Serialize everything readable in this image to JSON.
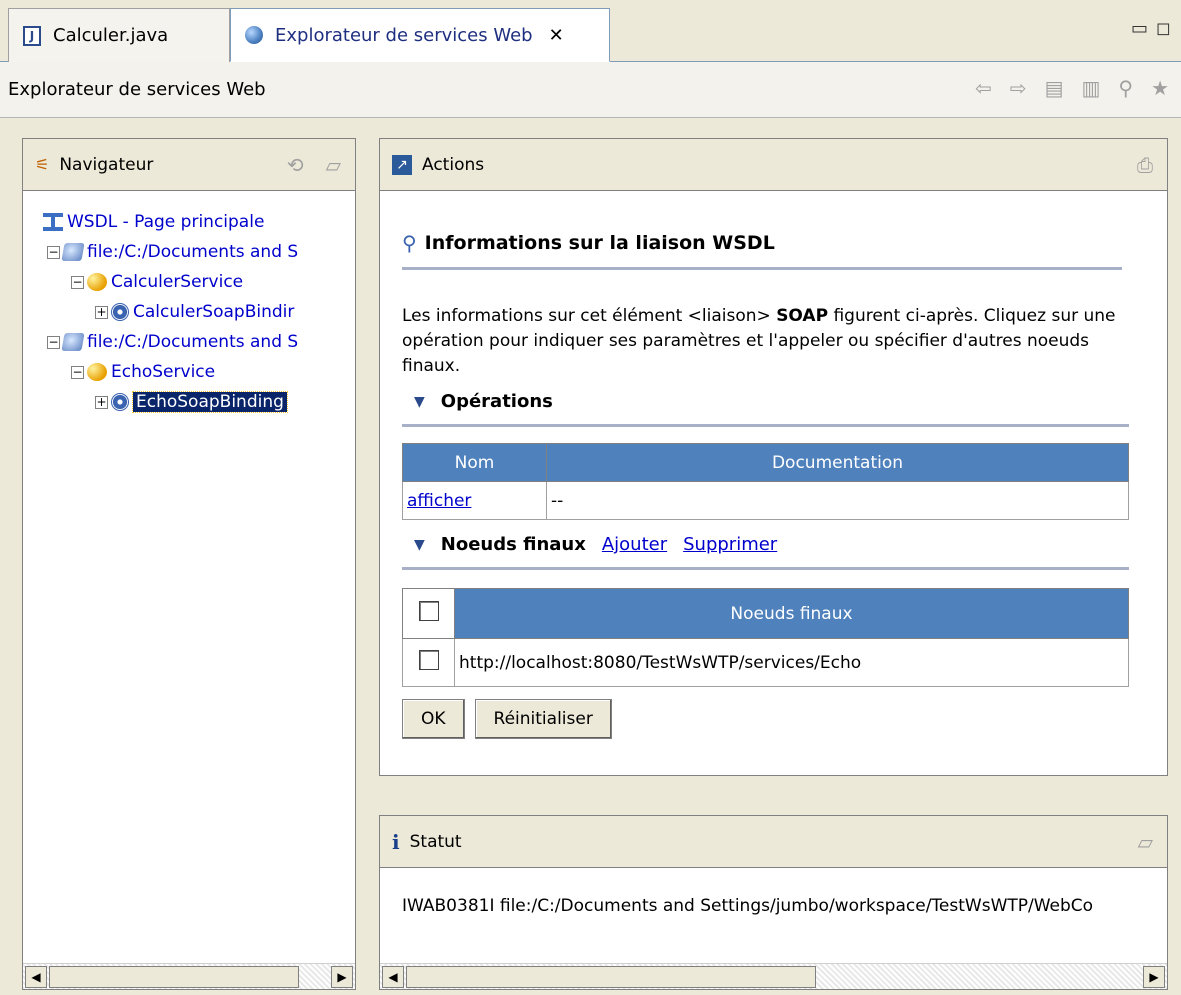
{
  "tabs": [
    {
      "label": "Calculer.java",
      "icon": "java-file-icon",
      "active": false
    },
    {
      "label": "Explorateur de services Web",
      "icon": "globe-icon",
      "active": true,
      "close": "✕"
    }
  ],
  "window_controls": {
    "minimize": "▭",
    "maximize": "◻"
  },
  "title": "Explorateur de services Web",
  "toolbar": [
    "back-icon",
    "forward-icon",
    "document-icon",
    "favorites-page-icon",
    "wsdl-search-icon",
    "star-icon"
  ],
  "navigator": {
    "header": "Navigateur",
    "tree": [
      {
        "label": "WSDL - Page principale",
        "level": 0,
        "icon": "wsdl-icon",
        "expander": ""
      },
      {
        "label": "file:/C:/Documents and S",
        "level": 1,
        "icon": "wsdl-file-icon",
        "expander": "−"
      },
      {
        "label": "CalculerService",
        "level": 2,
        "icon": "service-icon",
        "expander": "−"
      },
      {
        "label": "CalculerSoapBindir",
        "level": 3,
        "icon": "binding-icon",
        "expander": "+"
      },
      {
        "label": "file:/C:/Documents and S",
        "level": 1,
        "icon": "wsdl-file-icon",
        "expander": "−"
      },
      {
        "label": "EchoService",
        "level": 2,
        "icon": "service-icon",
        "expander": "−"
      },
      {
        "label": "EchoSoapBinding",
        "level": 3,
        "icon": "binding-icon",
        "expander": "+",
        "selected": true
      }
    ]
  },
  "actions": {
    "header": "Actions",
    "section_title": "Informations sur la liaison WSDL",
    "description_parts": {
      "before": "Les informations sur cet élément <liaison> ",
      "bold": "SOAP",
      "after": " figurent ci-après. Cliquez sur une opération pour indiquer ses paramètres et l'appeler ou spécifier d'autres noeuds finaux."
    },
    "operations": {
      "title": "Opérations",
      "columns": [
        "Nom",
        "Documentation"
      ],
      "rows": [
        {
          "name": "afficher",
          "doc": "--"
        }
      ]
    },
    "endpoints": {
      "title": "Noeuds finaux",
      "add": "Ajouter",
      "remove": "Supprimer",
      "column": "Noeuds finaux",
      "rows": [
        "http://localhost:8080/TestWsWTP/services/Echo"
      ]
    },
    "ok_button": "OK",
    "reset_button": "Réinitialiser"
  },
  "status": {
    "header": "Statut",
    "message": "IWAB0381I file:/C:/Documents and Settings/jumbo/workspace/TestWsWTP/WebCo"
  },
  "colors": {
    "table_header": "#4f81bd",
    "link": "#0000cc",
    "selection": "#0a246a"
  }
}
